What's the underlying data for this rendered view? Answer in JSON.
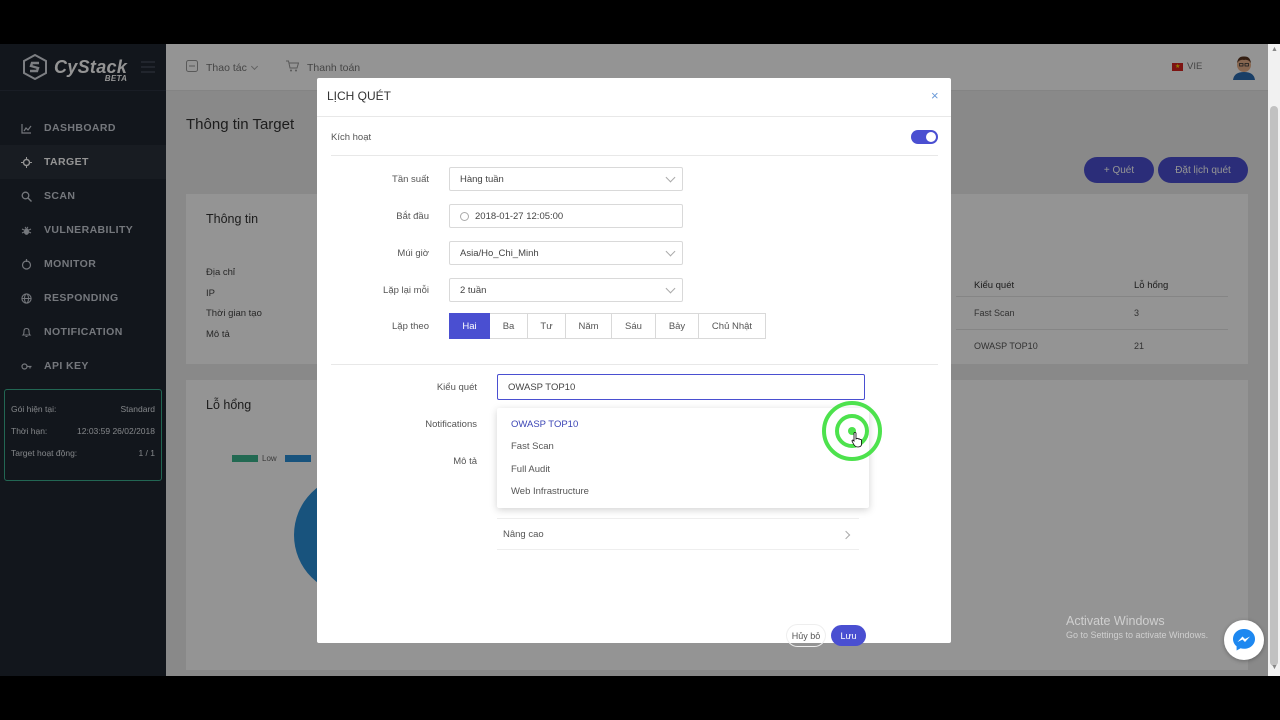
{
  "app": {
    "name": "CyStack",
    "badge": "BETA"
  },
  "sidebar": {
    "items": [
      {
        "label": "DASHBOARD",
        "icon": "chart-icon"
      },
      {
        "label": "TARGET",
        "icon": "target-icon"
      },
      {
        "label": "SCAN",
        "icon": "search-icon"
      },
      {
        "label": "VULNERABILITY",
        "icon": "bug-icon"
      },
      {
        "label": "MONITOR",
        "icon": "monitor-icon"
      },
      {
        "label": "RESPONDING",
        "icon": "globe-icon"
      },
      {
        "label": "NOTIFICATION",
        "icon": "bell-icon"
      },
      {
        "label": "API KEY",
        "icon": "key-icon"
      }
    ],
    "plan": {
      "rows": [
        {
          "label": "Gói hiện tại:",
          "value": "Standard"
        },
        {
          "label": "Thời hạn:",
          "value": "12:03:59 26/02/2018"
        },
        {
          "label": "Target hoạt động:",
          "value": "1 / 1"
        }
      ]
    }
  },
  "topbar": {
    "actions_label": "Thao tác",
    "payment_label": "Thanh toán",
    "language": "VIE"
  },
  "page": {
    "title": "Thông tin Target",
    "scan_button": "+ Quét",
    "schedule_button": "Đặt lịch quét",
    "info_card": {
      "title": "Thông tin",
      "labels": [
        "Địa chỉ",
        "IP",
        "Thời gian tạo",
        "Mô tả"
      ]
    },
    "scan_table": {
      "headers": [
        "Kiểu quét",
        "Lỗ hổng"
      ],
      "rows": [
        [
          "Fast Scan",
          "3"
        ],
        [
          "OWASP TOP10",
          "21"
        ]
      ]
    },
    "vuln_card": {
      "title": "Lỗ hổng",
      "legend_low": "Low"
    }
  },
  "modal": {
    "title": "LỊCH QUÉT",
    "close_icon": "×",
    "active_label": "Kích hoạt",
    "active": true,
    "frequency": {
      "label": "Tần suất",
      "value": "Hàng tuần"
    },
    "start": {
      "label": "Bắt đầu",
      "value": "2018-01-27 12:05:00"
    },
    "timezone": {
      "label": "Múi giờ",
      "value": "Asia/Ho_Chi_Minh"
    },
    "repeat": {
      "label": "Lặp lại mỗi",
      "value": "2 tuần"
    },
    "repeat_on": {
      "label": "Lặp theo",
      "days": [
        "Hai",
        "Ba",
        "Tư",
        "Năm",
        "Sáu",
        "Bảy",
        "Chủ Nhật"
      ],
      "selected": "Hai"
    },
    "scan_type": {
      "label": "Kiểu quét",
      "value": "OWASP TOP10",
      "options": [
        "OWASP TOP10",
        "Fast Scan",
        "Full Audit",
        "Web Infrastructure"
      ]
    },
    "notifications_label": "Notifications",
    "description_label": "Mô tả",
    "advanced_label": "Nâng cao",
    "cancel_button": "Hủy bỏ",
    "save_button": "Lưu"
  },
  "watermark": {
    "line1": "Activate Windows",
    "line2": "Go to Settings to activate Windows."
  },
  "colors": {
    "accent": "#4a4fd1",
    "sidebar": "#1f2631",
    "click_highlight": "#4de24d"
  }
}
